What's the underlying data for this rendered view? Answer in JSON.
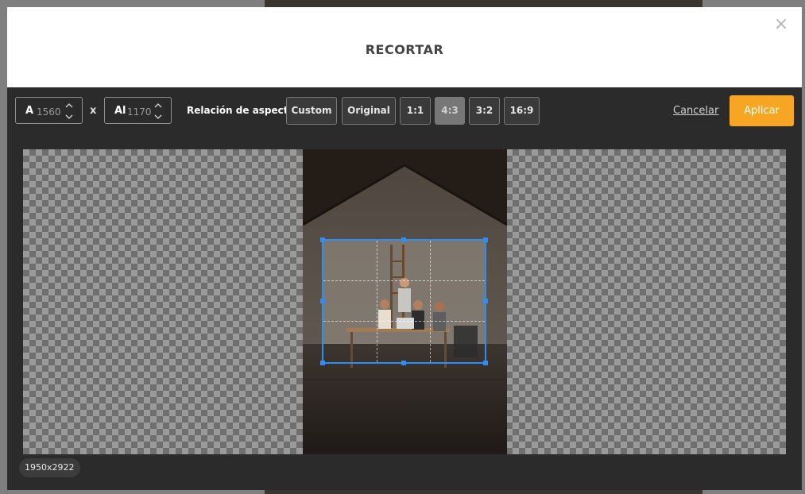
{
  "dialog": {
    "title": "RECORTAR",
    "close_symbol": "×"
  },
  "toolbar": {
    "width_label": "A",
    "width_value": "1560",
    "separator": "x",
    "height_label": "Al",
    "height_value": "1170",
    "aspect_label": "Relación de aspecto",
    "ratios": [
      {
        "label": "Custom",
        "active": false
      },
      {
        "label": "Original",
        "active": false
      },
      {
        "label": "1:1",
        "active": false
      },
      {
        "label": "4:3",
        "active": true
      },
      {
        "label": "3:2",
        "active": false
      },
      {
        "label": "16:9",
        "active": false
      }
    ],
    "cancel_label": "Cancelar",
    "apply_label": "Aplicar"
  },
  "image": {
    "size_badge": "1950x2922"
  },
  "colors": {
    "accent": "#f6a623",
    "crop_border": "#2f8ff0",
    "dark_panel": "#2b2b2b",
    "active_ratio_bg": "#777777"
  }
}
